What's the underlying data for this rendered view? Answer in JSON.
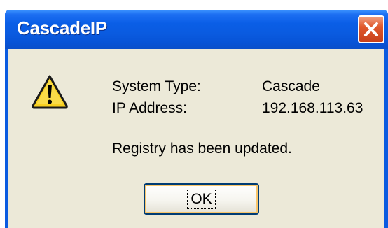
{
  "window": {
    "title": "CascadeIP"
  },
  "icons": {
    "warning": "warning-icon",
    "close": "close-icon"
  },
  "message": {
    "system_type_label": "System Type:",
    "system_type_value": "Cascade",
    "ip_address_label": "IP Address:",
    "ip_address_value": "192.168.113.63",
    "status": "Registry has been updated."
  },
  "buttons": {
    "ok_label": "OK"
  },
  "colors": {
    "titlebar": "#0a5be0",
    "close_button": "#e0582b",
    "dialog_face": "#ece9d8",
    "button_focus": "#f9c66b"
  }
}
